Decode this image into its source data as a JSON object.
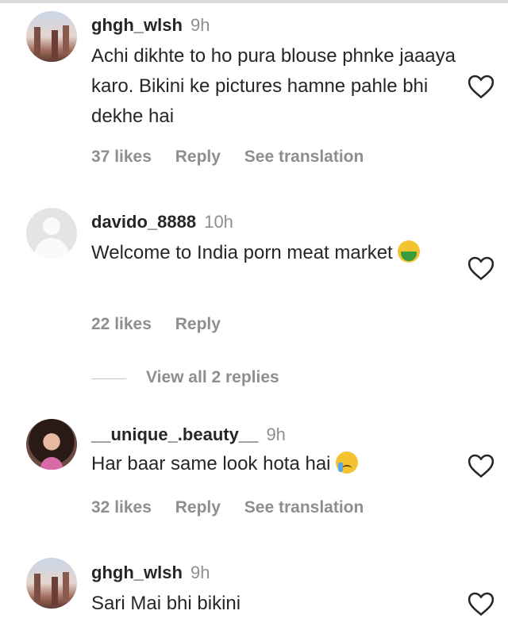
{
  "comments": [
    {
      "username": "ghgh_wlsh",
      "time": "9h",
      "text": "Achi dikhte to ho pura blouse phnke jaaaya karo. Bikini ke pictures hamne pahle bhi dekhe hai",
      "likes": "37 likes",
      "reply": "Reply",
      "translate": "See translation",
      "avatar": "landscape-avatar"
    },
    {
      "username": "davido_8888",
      "time": "10h",
      "text": "Welcome to India porn meat market",
      "emoji": "nauseated-face",
      "likes": "22 likes",
      "reply": "Reply",
      "avatar": "default-avatar"
    },
    {
      "username": "__unique_.beauty__",
      "time": "9h",
      "text": "Har baar same look hota hai",
      "emoji": "crying-face",
      "likes": "32 likes",
      "reply": "Reply",
      "translate": "See translation",
      "avatar": "portrait-avatar"
    },
    {
      "username": "ghgh_wlsh",
      "time": "9h",
      "text": "Sari Mai bhi bikini",
      "avatar": "landscape-avatar"
    }
  ],
  "view_replies": "View all 2 replies",
  "icons": {
    "like": "heart-outline-icon"
  },
  "colors": {
    "text": "#262626",
    "secondary": "#8e8e8e"
  }
}
